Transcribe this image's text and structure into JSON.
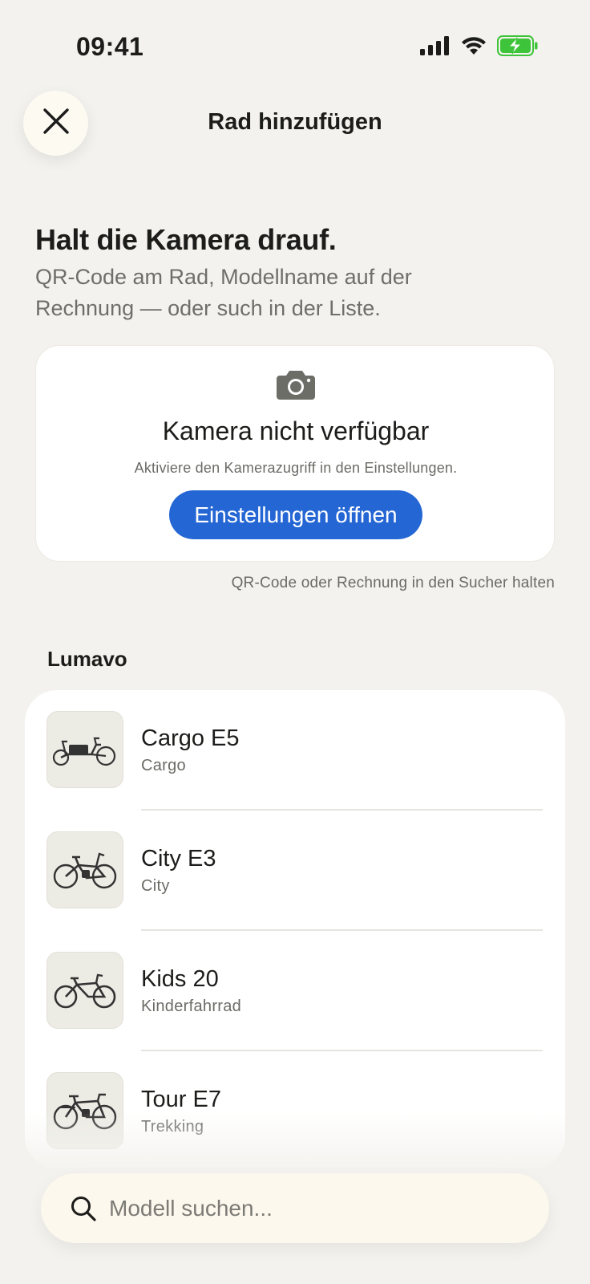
{
  "status_bar": {
    "time": "09:41",
    "icons": [
      "cellular-signal-icon",
      "wifi-icon",
      "battery-charging-icon"
    ],
    "battery_color": "#3ec43a"
  },
  "header": {
    "close_icon": "close-icon",
    "title": "Rad hinzufügen"
  },
  "intro": {
    "headline": "Halt die Kamera drauf.",
    "subtext": "QR-Code am Rad, Modellname auf der Rechnung — oder such in der Liste."
  },
  "camera_card": {
    "icon": "camera-icon",
    "title": "Kamera nicht verfügbar",
    "hint": "Aktiviere den Kamerazugriff in den Einstellungen.",
    "button_label": "Einstellungen öffnen",
    "button_color": "#2466d4"
  },
  "finder_hint": "QR-Code oder Rechnung in den Sucher halten",
  "brand": {
    "name": "Lumavo",
    "bikes": [
      {
        "name": "Cargo E5",
        "type": "Cargo",
        "icon": "cargo-bike-icon"
      },
      {
        "name": "City E3",
        "type": "City",
        "icon": "city-bike-icon"
      },
      {
        "name": "Kids 20",
        "type": "Kinderfahrrad",
        "icon": "kids-bike-icon"
      },
      {
        "name": "Tour E7",
        "type": "Trekking",
        "icon": "trekking-bike-icon"
      }
    ]
  },
  "search": {
    "icon": "search-icon",
    "placeholder": "Modell suchen..."
  }
}
